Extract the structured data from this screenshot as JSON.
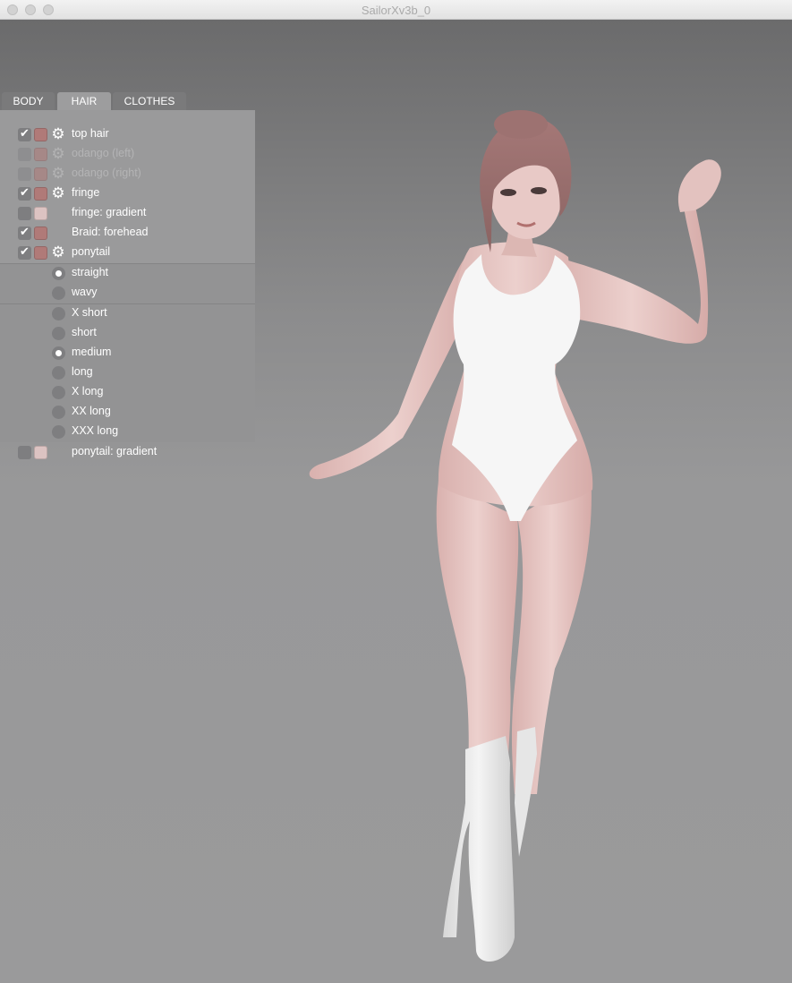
{
  "window": {
    "title": "SailorXv3b_0"
  },
  "tabs": [
    {
      "label": "BODY",
      "active": false
    },
    {
      "label": "HAIR",
      "active": true
    },
    {
      "label": "CLOTHES",
      "active": false
    }
  ],
  "hair_layers": [
    {
      "label": "top hair",
      "checked": true,
      "enabled": true,
      "swatch": "#b07a78",
      "gear": "gear-icon"
    },
    {
      "label": "odango (left)",
      "checked": false,
      "enabled": false,
      "swatch": "#b07a78",
      "gear": "gear-icon"
    },
    {
      "label": "odango (right)",
      "checked": false,
      "enabled": false,
      "swatch": "#b07a78",
      "gear": "gear-icon"
    },
    {
      "label": "fringe",
      "checked": true,
      "enabled": true,
      "swatch": "#b07a78",
      "gear": "gear-icon"
    },
    {
      "label": "fringe: gradient",
      "checked": false,
      "enabled": true,
      "swatch": "#dcc3c2"
    },
    {
      "label": "Braid: forehead",
      "checked": true,
      "enabled": true,
      "swatch": "#b07a78"
    },
    {
      "label": "ponytail",
      "checked": true,
      "enabled": true,
      "swatch": "#b07a78",
      "gear": "gear-icon"
    }
  ],
  "ponytail_style": {
    "options": [
      "straight",
      "wavy"
    ],
    "selected": "straight"
  },
  "ponytail_length": {
    "options": [
      "X short",
      "short",
      "medium",
      "long",
      "X long",
      "XX long",
      "XXX long"
    ],
    "selected": "medium"
  },
  "ponytail_gradient": {
    "label": "ponytail: gradient",
    "checked": false,
    "swatch": "#dcc3c2"
  },
  "colors": {
    "skin": "#e6c6c3",
    "hair": "#9a6d6c",
    "leotard": "#f6f6f6",
    "boots": "#eeeeee"
  }
}
